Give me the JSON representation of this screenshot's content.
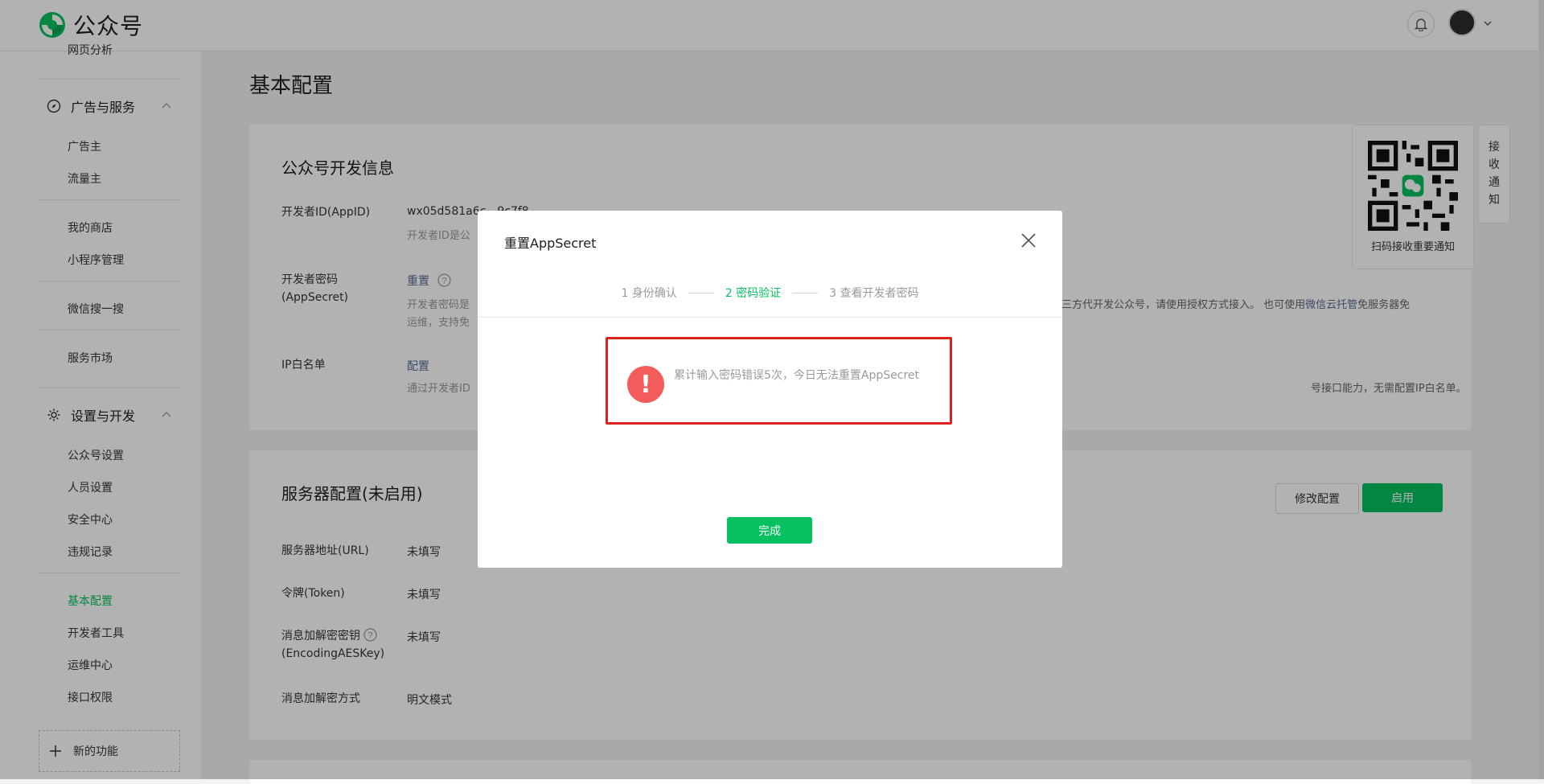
{
  "app": {
    "name": "公众号"
  },
  "sidebar": {
    "cut_item": "网页分析",
    "groups": [
      {
        "label": "广告与服务",
        "items": [
          "广告主",
          "流量主"
        ]
      },
      {
        "label": "设置与开发",
        "items": [
          "公众号设置",
          "人员设置",
          "安全中心",
          "违规记录",
          "基本配置",
          "开发者工具",
          "运维中心",
          "接口权限"
        ]
      }
    ],
    "standalone": [
      "我的商店",
      "小程序管理",
      "微信搜一搜",
      "服务市场"
    ],
    "active": "基本配置",
    "new_feature": "新的功能"
  },
  "page": {
    "title": "基本配置"
  },
  "dev_info": {
    "title": "公众号开发信息",
    "appid_label": "开发者ID(AppID)",
    "appid_value": "wx05d581a6c…9c7f8",
    "appid_desc": "开发者ID是公",
    "secret_label": "开发者密码(AppSecret)",
    "secret_action": "重置",
    "secret_desc_left": "开发者密码是",
    "secret_desc_left2": "运维，支持免",
    "secret_desc_right_pre": "三方代开发公众号，请使用授权方式接入。 也可使用",
    "secret_desc_right_link": "微信云托管",
    "secret_desc_right_post": "免服务器免",
    "ip_label": "IP白名单",
    "ip_action": "配置",
    "ip_desc_left": "通过开发者ID",
    "ip_desc_right": "号接口能力，无需配置IP白名单。"
  },
  "server_config": {
    "title": "服务器配置(未启用)",
    "edit_button": "修改配置",
    "enable_button": "启用",
    "rows": [
      {
        "label": "服务器地址(URL)",
        "value": "未填写"
      },
      {
        "label": "令牌(Token)",
        "value": "未填写"
      },
      {
        "label": "消息加解密密钥",
        "label2": "(EncodingAESKey)",
        "value": "未填写"
      },
      {
        "label": "消息加解密方式",
        "value": "明文模式"
      }
    ]
  },
  "qr": {
    "label": "扫码接收重要通知"
  },
  "notify_tab": {
    "label": "接收通知"
  },
  "dialog": {
    "title": "重置AppSecret",
    "steps": [
      "1 身份确认",
      "2 密码验证",
      "3 查看开发者密码"
    ],
    "active_step": 1,
    "error_message": "累计输入密码错误5次，今日无法重置AppSecret",
    "done_button": "完成"
  },
  "colors": {
    "accent": "#07c160",
    "error": "#f45c5c",
    "highlight_border": "#e01f1f",
    "link": "#576b95"
  }
}
